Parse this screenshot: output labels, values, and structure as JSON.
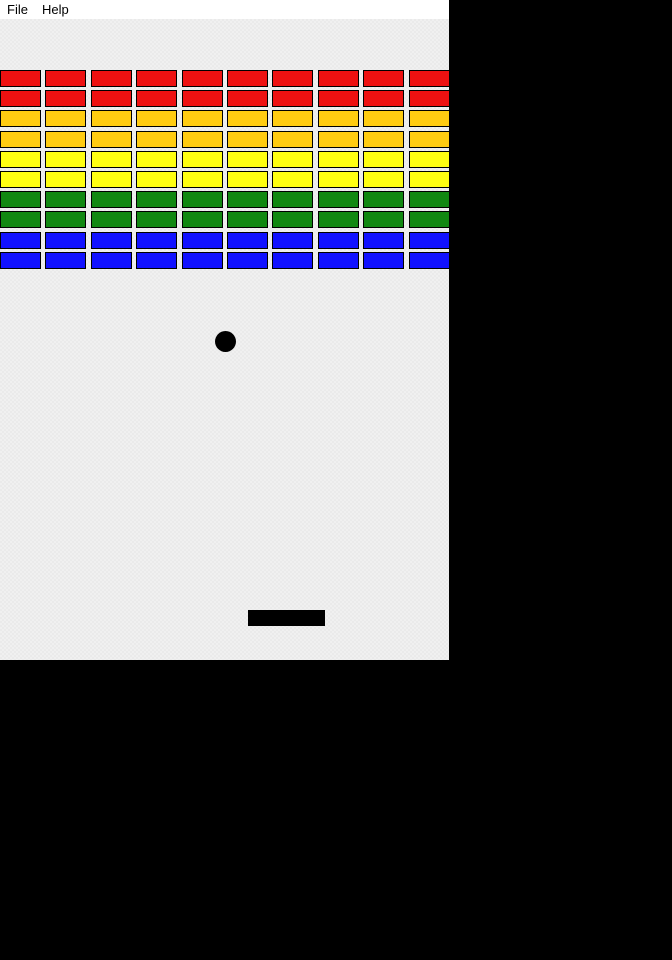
{
  "menu": {
    "items": [
      {
        "label": "File"
      },
      {
        "label": "Help"
      }
    ]
  },
  "game": {
    "brick_columns": 10,
    "brick_rows": [
      {
        "color": "#ee1111"
      },
      {
        "color": "#ee1111"
      },
      {
        "color": "#ffcc11"
      },
      {
        "color": "#ffcc11"
      },
      {
        "color": "#ffff11"
      },
      {
        "color": "#ffff11"
      },
      {
        "color": "#118811"
      },
      {
        "color": "#118811"
      },
      {
        "color": "#1111ff"
      },
      {
        "color": "#1111ff"
      }
    ],
    "ball_color": "#000000",
    "paddle_color": "#000000",
    "background_color": "#f0f0f0"
  }
}
